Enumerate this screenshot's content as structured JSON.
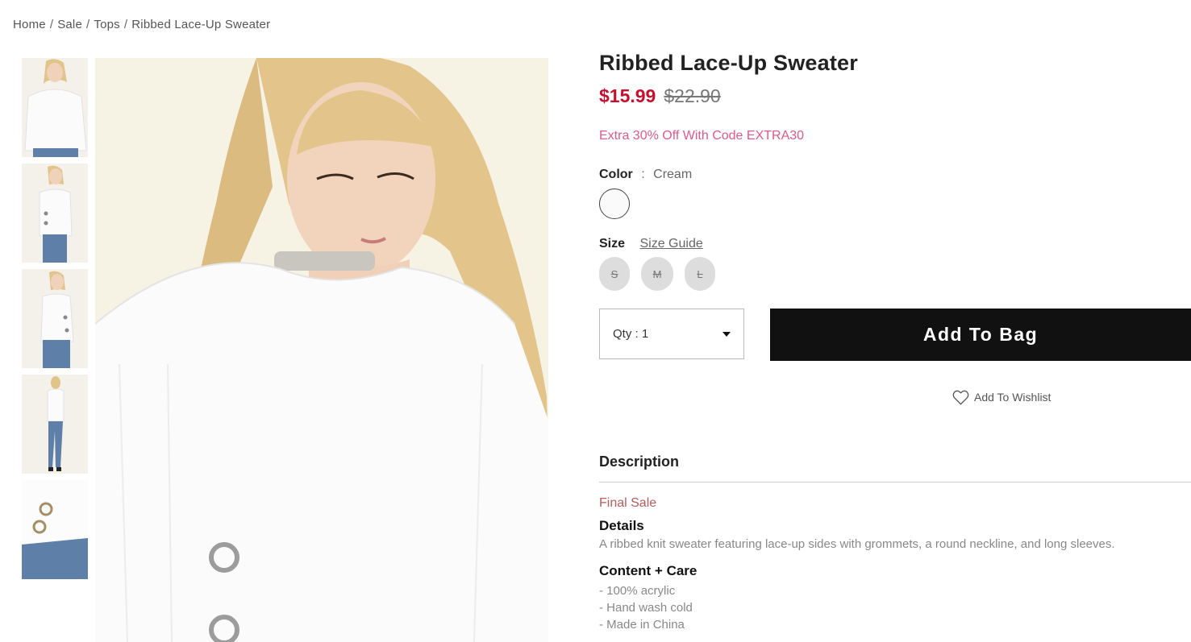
{
  "breadcrumb": [
    {
      "label": "Home"
    },
    {
      "label": "Sale"
    },
    {
      "label": "Tops"
    },
    {
      "label": "Ribbed Lace-Up Sweater"
    }
  ],
  "breadcrumb_separator": "/",
  "product": {
    "title": "Ribbed Lace-Up Sweater",
    "sale_price": "$15.99",
    "original_price": "$22.90",
    "promo": "Extra 30% Off With Code EXTRA30",
    "color_label": "Color",
    "color_sep": ":",
    "color_value": "Cream",
    "swatch_color": "#fafafa",
    "size_label": "Size",
    "size_guide": "Size Guide",
    "sizes": [
      "S",
      "M",
      "L"
    ],
    "qty_label": "Qty : 1",
    "add_to_bag": "Add To Bag",
    "wishlist": "Add To Wishlist"
  },
  "description": {
    "heading": "Description",
    "final_sale": "Final Sale",
    "details_heading": "Details",
    "details_text": "A ribbed knit sweater featuring lace-up sides with grommets, a round neckline, and long sleeves.",
    "care_heading": "Content + Care",
    "care_items": [
      "- 100% acrylic",
      "- Hand wash cold",
      "- Made in China"
    ]
  },
  "colors": {
    "sale": "#c8102e",
    "promo": "#e0598b",
    "final_sale": "#b75b5b",
    "button_bg": "#111111"
  }
}
